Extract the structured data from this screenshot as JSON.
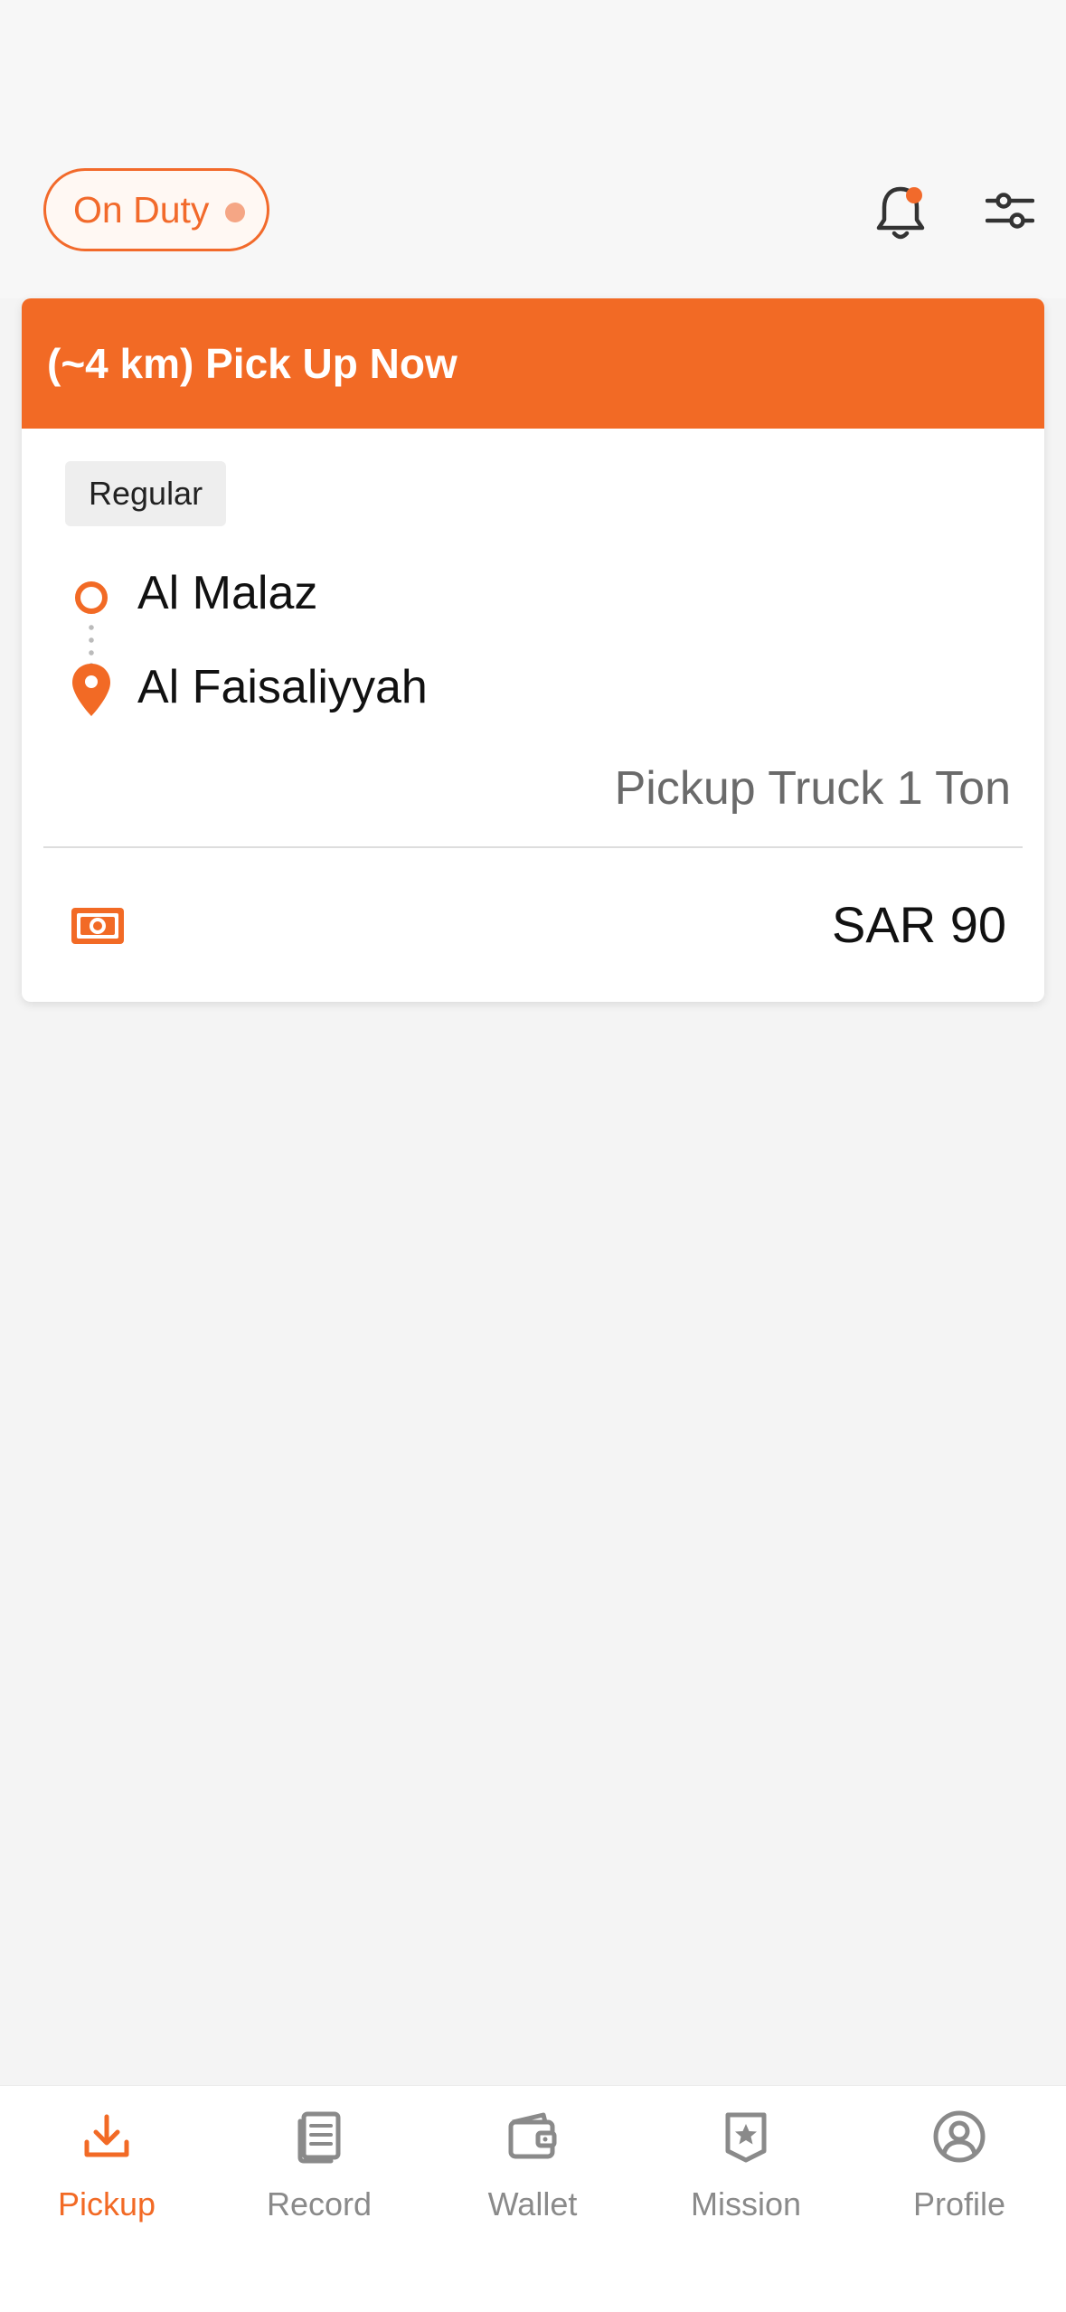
{
  "header": {
    "duty_status": "On Duty"
  },
  "order": {
    "title": "(~4 km) Pick Up Now",
    "tag": "Regular",
    "origin": "Al Malaz",
    "destination": "Al Faisaliyyah",
    "vehicle": "Pickup Truck 1 Ton",
    "price": "SAR 90"
  },
  "tabs": [
    {
      "label": "Pickup",
      "icon": "download-icon",
      "active": true
    },
    {
      "label": "Record",
      "icon": "document-icon",
      "active": false
    },
    {
      "label": "Wallet",
      "icon": "wallet-icon",
      "active": false
    },
    {
      "label": "Mission",
      "icon": "star-badge-icon",
      "active": false
    },
    {
      "label": "Profile",
      "icon": "user-circle-icon",
      "active": false
    }
  ],
  "colors": {
    "accent": "#f26a25",
    "background": "#f4f4f4",
    "card": "#ffffff",
    "inactive_tab": "#8a8a8a"
  }
}
